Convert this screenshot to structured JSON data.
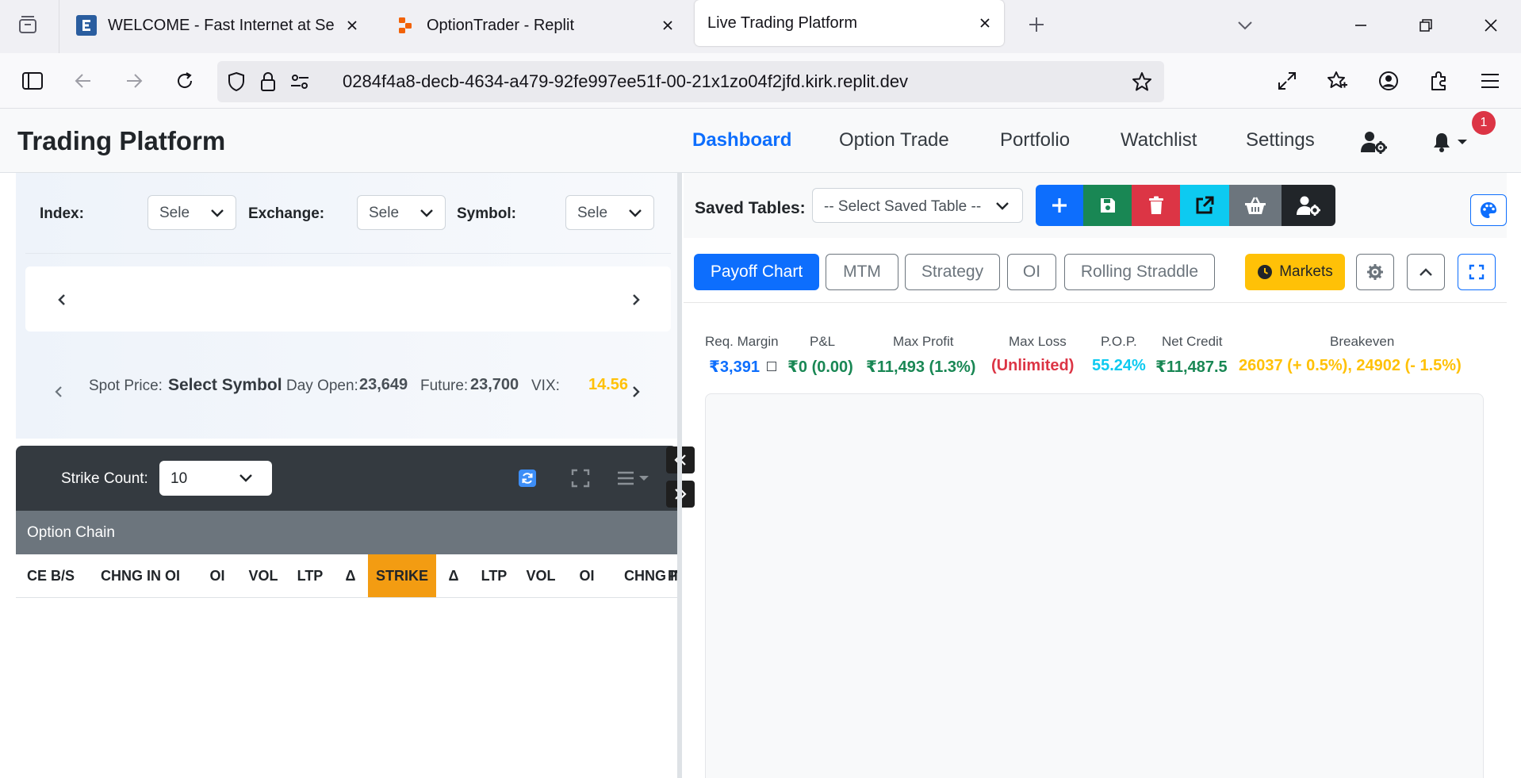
{
  "browser": {
    "tabs": [
      {
        "title": "WELCOME - Fast Internet at Sea",
        "favicon": "letter-e-favicon"
      },
      {
        "title": "OptionTrader - Replit",
        "favicon": "replit-favicon"
      },
      {
        "title": "Live Trading Platform",
        "favicon": "none"
      }
    ],
    "url": "0284f4a8-decb-4634-a479-92fe997ee51f-00-21x1zo04f2jfd.kirk.replit.dev"
  },
  "header": {
    "brand": "Trading Platform",
    "nav": [
      "Dashboard",
      "Option Trade",
      "Portfolio",
      "Watchlist",
      "Settings"
    ],
    "active_nav": "Dashboard",
    "notification_count": "1"
  },
  "filters": {
    "index_label": "Index:",
    "index_value": "Sele",
    "exchange_label": "Exchange:",
    "exchange_value": "Sele",
    "symbol_label": "Symbol:",
    "symbol_value": "Sele"
  },
  "spot": {
    "spot_label": "Spot Price:",
    "spot_value": "Select Symbol",
    "day_open_label": "Day Open:",
    "day_open_value": "23,649",
    "future_label": "Future:",
    "future_value": "23,700",
    "vix_label": "VIX:",
    "vix_value": "14.56"
  },
  "chain": {
    "strike_count_label": "Strike Count:",
    "strike_count_value": "10",
    "title": "Option Chain",
    "columns": [
      "CE B/S",
      "CHNG IN OI",
      "OI",
      "VOL",
      "LTP",
      "Δ",
      "STRIKE",
      "Δ",
      "LTP",
      "VOL",
      "OI",
      "CHNG IN OI",
      "P"
    ]
  },
  "saved": {
    "label": "Saved Tables:",
    "placeholder": "-- Select Saved Table --"
  },
  "panel_tabs": [
    "Payoff Chart",
    "MTM",
    "Strategy",
    "OI",
    "Rolling Straddle"
  ],
  "markets_label": "Markets",
  "metrics": [
    {
      "label": "Req. Margin",
      "value": "₹3,391",
      "color": "#0d6efd"
    },
    {
      "label": "P&L",
      "value": "₹0 (0.00)",
      "color": "#198754"
    },
    {
      "label": "Max Profit",
      "value": "₹11,493 (1.3%)",
      "color": "#198754"
    },
    {
      "label": "Max Loss",
      "value": "(Unlimited)",
      "color": "#dc3545"
    },
    {
      "label": "P.O.P.",
      "value": "55.24%",
      "color": "#0dcaf0"
    },
    {
      "label": "Net Credit",
      "value": "₹11,487.5",
      "color": "#198754"
    },
    {
      "label": "Breakeven",
      "value": "26037 (+ 0.5%), 24902 (- 1.5%)",
      "color": "#ffc107"
    }
  ],
  "colors": {
    "primary": "#0d6efd",
    "success": "#198754",
    "danger": "#dc3545",
    "info": "#0dcaf0",
    "secondary": "#6c757d",
    "dark": "#343a40",
    "warning": "#ffc107",
    "strike": "#f39c12"
  }
}
